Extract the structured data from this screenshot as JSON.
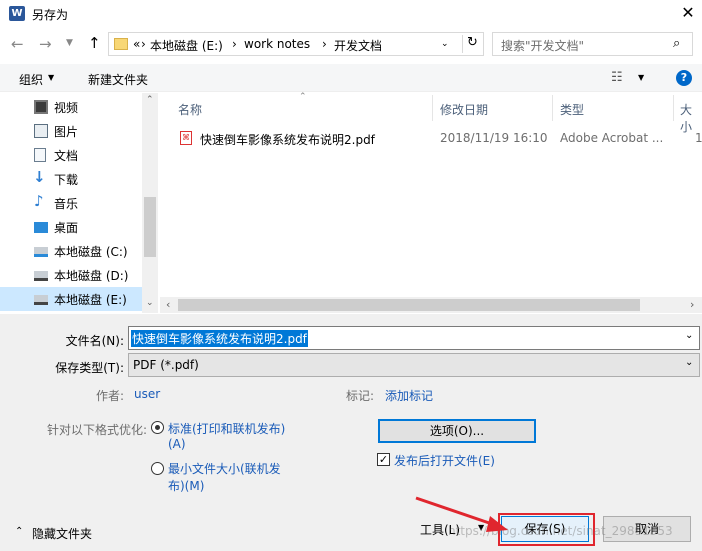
{
  "window": {
    "title": "另存为"
  },
  "addressbar": {
    "prefix": "«",
    "crumbs": [
      "本地磁盘 (E:)",
      "work notes",
      "开发文档"
    ],
    "search_placeholder": "搜索\"开发文档\""
  },
  "toolbar": {
    "organize": "组织",
    "new_folder": "新建文件夹",
    "help": "?"
  },
  "sidebar": {
    "items": [
      {
        "label": "视频",
        "icon": "video-icon"
      },
      {
        "label": "图片",
        "icon": "picture-icon"
      },
      {
        "label": "文档",
        "icon": "document-icon"
      },
      {
        "label": "下载",
        "icon": "download-icon"
      },
      {
        "label": "音乐",
        "icon": "music-icon"
      },
      {
        "label": "桌面",
        "icon": "desktop-icon"
      },
      {
        "label": "本地磁盘 (C:)",
        "icon": "drive-icon"
      },
      {
        "label": "本地磁盘 (D:)",
        "icon": "drive-icon"
      },
      {
        "label": "本地磁盘 (E:)",
        "icon": "drive-icon",
        "selected": true
      }
    ]
  },
  "file_list": {
    "columns": [
      "名称",
      "修改日期",
      "类型",
      "大小"
    ],
    "rows": [
      {
        "name": "快速倒车影像系统发布说明2.pdf",
        "modified": "2018/11/19 16:10",
        "type": "Adobe Acrobat ...",
        "size": "1"
      }
    ]
  },
  "form": {
    "filename_label": "文件名(N):",
    "filename_value": "快速倒车影像系统发布说明2.pdf",
    "filetype_label": "保存类型(T):",
    "filetype_value": "PDF (*.pdf)",
    "author_label": "作者:",
    "author_value": "user",
    "tags_label": "标记:",
    "tags_value": "添加标记",
    "optimize_label": "针对以下格式优化:",
    "opt_standard_line1": "标准(打印和联机发布)",
    "opt_standard_line2": "(A)",
    "opt_min_line1": "最小文件大小(联机发",
    "opt_min_line2": "布)(M)",
    "options_button": "选项(O)...",
    "open_after_label": "发布后打开文件(E)"
  },
  "footer": {
    "hide_folders": "隐藏文件夹",
    "tools": "工具(L)",
    "save": "保存(S)",
    "cancel": "取消",
    "watermark": "https://blog.csdn.net/sinat_29891353"
  },
  "colors": {
    "accent": "#0078d7",
    "selection": "#cce8ff",
    "annotation": "#e0262e"
  }
}
